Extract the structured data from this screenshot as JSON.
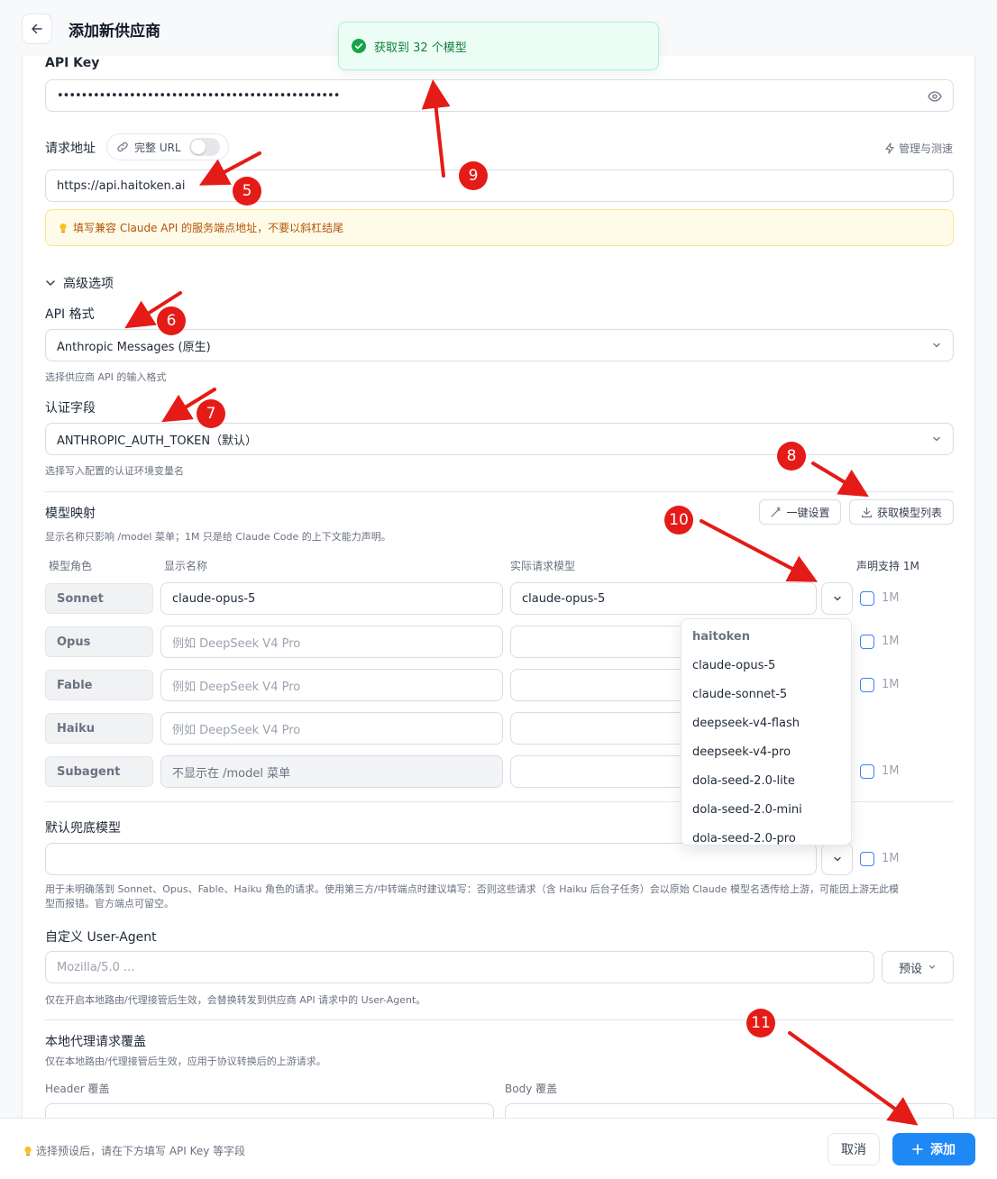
{
  "header": {
    "title": "添加新供应商"
  },
  "toast": {
    "message": "获取到 32 个模型",
    "color": "#15803d"
  },
  "api_key": {
    "label": "API Key",
    "value": "•••••••••••••••••••••••••••••••••••••••••••••••"
  },
  "endpoint": {
    "label": "请求地址",
    "full_url_label": "完整 URL",
    "full_url_enabled": false,
    "manage_label": "管理与测速",
    "value": "https://api.haitoken.ai",
    "warning": "填写兼容 Claude API 的服务端点地址，不要以斜杠结尾"
  },
  "advanced": {
    "toggle_label": "高级选项",
    "api_format": {
      "label": "API 格式",
      "value": "Anthropic Messages (原生)",
      "hint": "选择供应商 API 的输入格式"
    },
    "auth_field": {
      "label": "认证字段",
      "value": "ANTHROPIC_AUTH_TOKEN（默认）",
      "hint": "选择写入配置的认证环境变量名"
    }
  },
  "model_mapping": {
    "title": "模型映射",
    "hint": "显示名称只影响 /model 菜单；1M 只是给 Claude Code 的上下文能力声明。",
    "one_click_label": "一键设置",
    "fetch_label": "获取模型列表",
    "columns": [
      "模型角色",
      "显示名称",
      "实际请求模型",
      "声明支持 1M"
    ],
    "rows": [
      {
        "role": "Sonnet",
        "display": "claude-opus-5",
        "display_placeholder": "",
        "model": "claude-opus-5",
        "flag": "1M"
      },
      {
        "role": "Opus",
        "display": "",
        "display_placeholder": "例如 DeepSeek V4 Pro",
        "model": "",
        "flag": "1M"
      },
      {
        "role": "Fable",
        "display": "",
        "display_placeholder": "例如 DeepSeek V4 Pro",
        "model": "",
        "flag": "1M"
      },
      {
        "role": "Haiku",
        "display": "",
        "display_placeholder": "例如 DeepSeek V4 Pro",
        "model": "",
        "flag": ""
      },
      {
        "role": "Subagent",
        "display": "",
        "display_placeholder": "不显示在 /model 菜单",
        "model": "",
        "flag": "1M"
      }
    ],
    "dropdown": {
      "group": "haitoken",
      "items": [
        "claude-opus-5",
        "claude-sonnet-5",
        "deepseek-v4-flash",
        "deepseek-v4-pro",
        "dola-seed-2.0-lite",
        "dola-seed-2.0-mini",
        "dola-seed-2.0-pro"
      ]
    }
  },
  "fallback": {
    "label": "默认兜底模型",
    "flag": "1M",
    "hint_line1": "用于未明确落到 Sonnet、Opus、Fable、Haiku 角色的请求。使用第三方/中转端点时建议填写：否则这些请求（含 Haiku 后台子任务）会以原始 Claude 模型名透传给上游，可能因上游无此模",
    "hint_line2": "型而报错。官方端点可留空。"
  },
  "user_agent": {
    "label": "自定义 User-Agent",
    "placeholder": "Mozilla/5.0 ...",
    "preset_label": "预设",
    "hint": "仅在开启本地路由/代理接管后生效，会替换转发到供应商 API 请求中的 User-Agent。"
  },
  "override": {
    "title": "本地代理请求覆盖",
    "hint": "仅在本地路由/代理接管后生效，应用于协议转换后的上游请求。",
    "header_label": "Header 覆盖",
    "body_label": "Body 覆盖",
    "header_value": "{",
    "body_value": "{"
  },
  "footer": {
    "hint": "选择预设后，请在下方填写 API Key 等字段",
    "cancel_label": "取消",
    "add_label": "添加",
    "accent": "#1e88f5"
  },
  "markers": [
    "5",
    "6",
    "7",
    "8",
    "9",
    "10",
    "11"
  ],
  "marker_color": "#e41b17"
}
